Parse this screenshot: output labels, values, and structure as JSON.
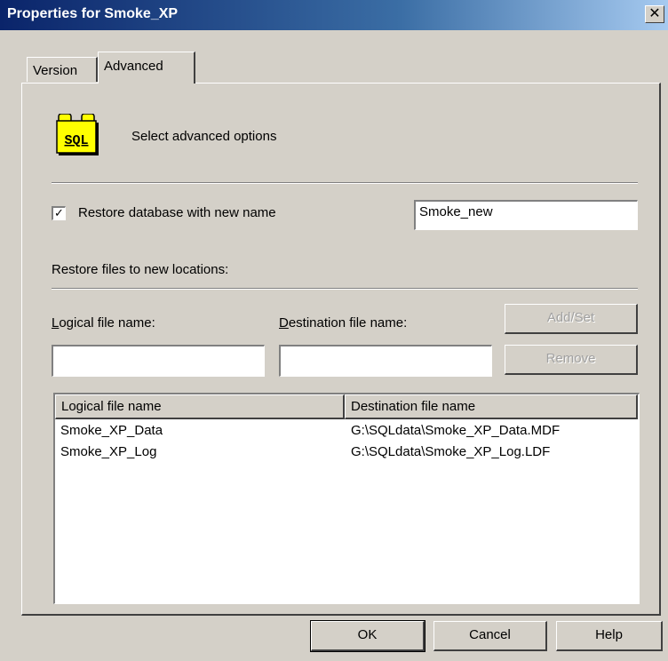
{
  "window": {
    "title": "Properties for Smoke_XP",
    "close_glyph": "✕"
  },
  "tabs": [
    {
      "label": "Version",
      "active": false
    },
    {
      "label": "Advanced",
      "active": true
    }
  ],
  "header": {
    "icon": "sql-database-icon",
    "icon_text": "SQL",
    "caption": "Select advanced options"
  },
  "restore_new_name": {
    "checked": true,
    "check_glyph": "✓",
    "label": "Restore database with new name",
    "value": "Smoke_new"
  },
  "relocate": {
    "section_label": "Restore files to new locations:",
    "logical_label_u": "L",
    "logical_label_rest": "ogical file name:",
    "destination_label_u": "D",
    "destination_label_rest": "estination file name:",
    "logical_value": "",
    "destination_value": "",
    "add_set_label": "Add/Set",
    "remove_label": "Remove"
  },
  "file_list": {
    "columns": [
      "Logical file name",
      "Destination file name"
    ],
    "rows": [
      [
        "Smoke_XP_Data",
        "G:\\SQLdata\\Smoke_XP_Data.MDF"
      ],
      [
        "Smoke_XP_Log",
        "G:\\SQLdata\\Smoke_XP_Log.LDF"
      ]
    ]
  },
  "footer": {
    "ok_label": "OK",
    "cancel_label": "Cancel",
    "help_label": "Help"
  }
}
